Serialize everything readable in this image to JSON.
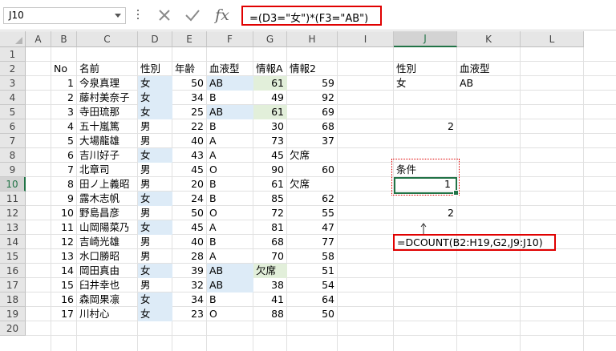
{
  "namebox": {
    "value": "J10"
  },
  "formula_bar": {
    "formula": "=(D3=\"女\")*(F3=\"AB\")"
  },
  "columns": [
    "A",
    "B",
    "C",
    "D",
    "E",
    "F",
    "G",
    "H",
    "I",
    "J",
    "K",
    "L"
  ],
  "selected_column": "J",
  "selected_row": "10",
  "row_numbers": [
    "1",
    "2",
    "3",
    "4",
    "5",
    "6",
    "7",
    "8",
    "9",
    "10",
    "11",
    "12",
    "13",
    "14",
    "15",
    "16",
    "17",
    "18",
    "19",
    "20"
  ],
  "table": {
    "headers": [
      "No",
      "名前",
      "性別",
      "年齢",
      "血液型",
      "情報A",
      "情報2"
    ],
    "rows": [
      [
        "1",
        "今泉真理",
        "女",
        "50",
        "AB",
        "61",
        "59"
      ],
      [
        "2",
        "藤村美奈子",
        "女",
        "34",
        "B",
        "49",
        "92"
      ],
      [
        "3",
        "寺田琉那",
        "女",
        "25",
        "AB",
        "61",
        "69"
      ],
      [
        "4",
        "五十嵐篤",
        "男",
        "22",
        "B",
        "30",
        "68"
      ],
      [
        "5",
        "大場龍雄",
        "男",
        "40",
        "A",
        "73",
        "37"
      ],
      [
        "6",
        "吉川好子",
        "女",
        "43",
        "A",
        "45",
        "欠席"
      ],
      [
        "7",
        "北章司",
        "男",
        "45",
        "O",
        "90",
        "60"
      ],
      [
        "8",
        "田ノ上義昭",
        "男",
        "20",
        "B",
        "61",
        "欠席"
      ],
      [
        "9",
        "露木志帆",
        "女",
        "24",
        "B",
        "85",
        "62"
      ],
      [
        "10",
        "野島昌彦",
        "男",
        "50",
        "O",
        "72",
        "55"
      ],
      [
        "11",
        "山岡陽菜乃",
        "女",
        "45",
        "A",
        "81",
        "47"
      ],
      [
        "12",
        "吉崎光雄",
        "男",
        "40",
        "B",
        "68",
        "77"
      ],
      [
        "13",
        "水口勝昭",
        "男",
        "28",
        "A",
        "70",
        "58"
      ],
      [
        "14",
        "岡田真由",
        "女",
        "39",
        "AB",
        "欠席",
        "51"
      ],
      [
        "15",
        "臼井幸也",
        "男",
        "32",
        "AB",
        "38",
        "54"
      ],
      [
        "16",
        "森岡果凛",
        "女",
        "34",
        "B",
        "41",
        "64"
      ],
      [
        "17",
        "川村心",
        "女",
        "23",
        "O",
        "88",
        "50"
      ]
    ]
  },
  "criteria": {
    "j2": "性別",
    "k2": "血液型",
    "j3": "女",
    "k3": "AB",
    "j6": "2",
    "j9": "条件",
    "j10": "1",
    "j12": "2",
    "dcount_formula": "=DCOUNT(B2:H19,G2,J9:J10)"
  },
  "colors": {
    "accent": "#217346",
    "highlight_border": "#e00000",
    "blue_fill": "#ddebf7",
    "green_fill": "#e2efda"
  }
}
